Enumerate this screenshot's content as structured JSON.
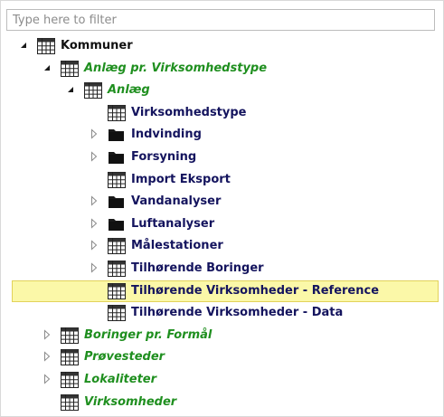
{
  "filter": {
    "placeholder": "Type here to filter",
    "value": ""
  },
  "colors": {
    "black": "#111111",
    "navy": "#14145e",
    "green": "#1f8f1f",
    "selection_bg": "#fbf8a8",
    "selection_border": "#e2d25a"
  },
  "tree": {
    "nodes": [
      {
        "label": "Kommuner",
        "level": 0,
        "expander": "expanded",
        "icon": "table-icon",
        "color": "black",
        "selected": false
      },
      {
        "label": "Anlæg pr. Virksomhedstype",
        "level": 1,
        "expander": "expanded",
        "icon": "table-icon",
        "color": "green",
        "selected": false
      },
      {
        "label": "Anlæg",
        "level": 2,
        "expander": "expanded",
        "icon": "table-icon",
        "color": "green",
        "selected": false
      },
      {
        "label": "Virksomhedstype",
        "level": 3,
        "expander": "none",
        "icon": "table-icon",
        "color": "navy",
        "selected": false
      },
      {
        "label": "Indvinding",
        "level": 3,
        "expander": "collapsed",
        "icon": "folder-icon",
        "color": "navy",
        "selected": false
      },
      {
        "label": "Forsyning",
        "level": 3,
        "expander": "collapsed",
        "icon": "folder-icon",
        "color": "navy",
        "selected": false
      },
      {
        "label": "Import Eksport",
        "level": 3,
        "expander": "none",
        "icon": "table-icon",
        "color": "navy",
        "selected": false
      },
      {
        "label": "Vandanalyser",
        "level": 3,
        "expander": "collapsed",
        "icon": "folder-icon",
        "color": "navy",
        "selected": false
      },
      {
        "label": "Luftanalyser",
        "level": 3,
        "expander": "collapsed",
        "icon": "folder-icon",
        "color": "navy",
        "selected": false
      },
      {
        "label": "Målestationer",
        "level": 3,
        "expander": "collapsed",
        "icon": "table-icon",
        "color": "navy",
        "selected": false
      },
      {
        "label": "Tilhørende Boringer",
        "level": 3,
        "expander": "collapsed",
        "icon": "table-icon",
        "color": "navy",
        "selected": false
      },
      {
        "label": "Tilhørende Virksomheder - Reference",
        "level": 3,
        "expander": "none",
        "icon": "table-icon",
        "color": "navy",
        "selected": true
      },
      {
        "label": "Tilhørende Virksomheder - Data",
        "level": 3,
        "expander": "none",
        "icon": "table-icon",
        "color": "navy",
        "selected": false
      },
      {
        "label": "Boringer pr. Formål",
        "level": 1,
        "expander": "collapsed",
        "icon": "table-icon",
        "color": "green",
        "selected": false
      },
      {
        "label": "Prøvesteder",
        "level": 1,
        "expander": "collapsed",
        "icon": "table-icon",
        "color": "green",
        "selected": false
      },
      {
        "label": "Lokaliteter",
        "level": 1,
        "expander": "collapsed",
        "icon": "table-icon",
        "color": "green",
        "selected": false
      },
      {
        "label": "Virksomheder",
        "level": 1,
        "expander": "none",
        "icon": "table-icon",
        "color": "green",
        "selected": false
      }
    ]
  }
}
